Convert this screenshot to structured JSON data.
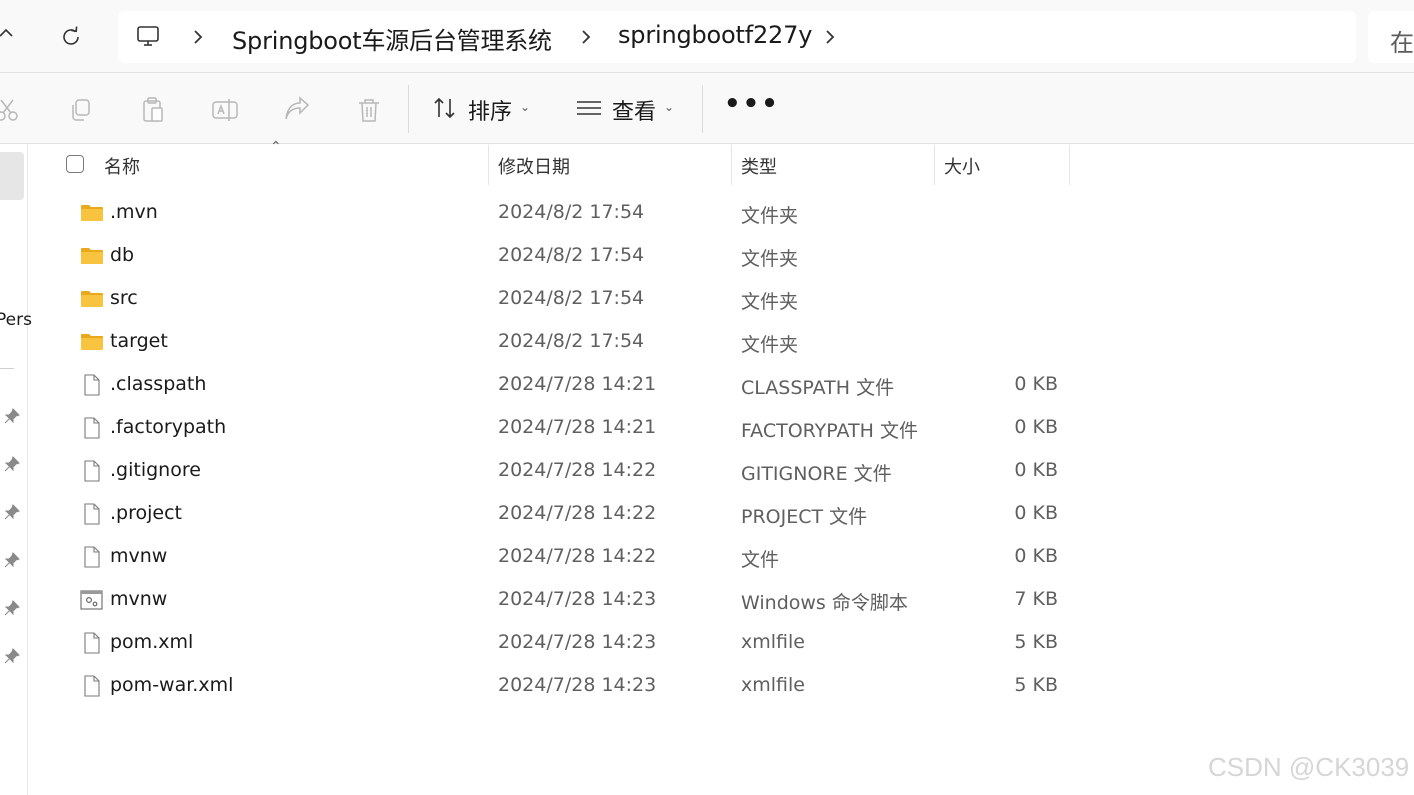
{
  "breadcrumb": {
    "items": [
      "Springboot车源后台管理系统",
      "springbootf227y"
    ],
    "search_hint": "在"
  },
  "toolbar": {
    "sort_label": "排序",
    "view_label": "查看",
    "more_label": "•••"
  },
  "navpane": {
    "partial_label": "Pers"
  },
  "columns": {
    "name": "名称",
    "date": "修改日期",
    "type": "类型",
    "size": "大小"
  },
  "files": [
    {
      "name": ".mvn",
      "date": "2024/8/2 17:54",
      "type": "文件夹",
      "size": "",
      "icon": "folder-icon"
    },
    {
      "name": "db",
      "date": "2024/8/2 17:54",
      "type": "文件夹",
      "size": "",
      "icon": "folder-icon"
    },
    {
      "name": "src",
      "date": "2024/8/2 17:54",
      "type": "文件夹",
      "size": "",
      "icon": "folder-icon"
    },
    {
      "name": "target",
      "date": "2024/8/2 17:54",
      "type": "文件夹",
      "size": "",
      "icon": "folder-icon"
    },
    {
      "name": ".classpath",
      "date": "2024/7/28 14:21",
      "type": "CLASSPATH 文件",
      "size": "0 KB",
      "icon": "file-icon"
    },
    {
      "name": ".factorypath",
      "date": "2024/7/28 14:21",
      "type": "FACTORYPATH 文件",
      "size": "0 KB",
      "icon": "file-icon"
    },
    {
      "name": ".gitignore",
      "date": "2024/7/28 14:22",
      "type": "GITIGNORE 文件",
      "size": "0 KB",
      "icon": "file-icon"
    },
    {
      "name": ".project",
      "date": "2024/7/28 14:22",
      "type": "PROJECT 文件",
      "size": "0 KB",
      "icon": "file-icon"
    },
    {
      "name": "mvnw",
      "date": "2024/7/28 14:22",
      "type": "文件",
      "size": "0 KB",
      "icon": "file-icon"
    },
    {
      "name": "mvnw",
      "date": "2024/7/28 14:23",
      "type": "Windows 命令脚本",
      "size": "7 KB",
      "icon": "script-icon"
    },
    {
      "name": "pom.xml",
      "date": "2024/7/28 14:23",
      "type": "xmlfile",
      "size": "5 KB",
      "icon": "file-icon"
    },
    {
      "name": "pom-war.xml",
      "date": "2024/7/28 14:23",
      "type": "xmlfile",
      "size": "5 KB",
      "icon": "file-icon"
    }
  ],
  "watermark": "CSDN @CK3039",
  "colors": {
    "folder": "#f8c440",
    "folder_dark": "#e8a91c",
    "text_secondary": "#5f5f5f",
    "chrome_bg": "#f9f9f9"
  }
}
